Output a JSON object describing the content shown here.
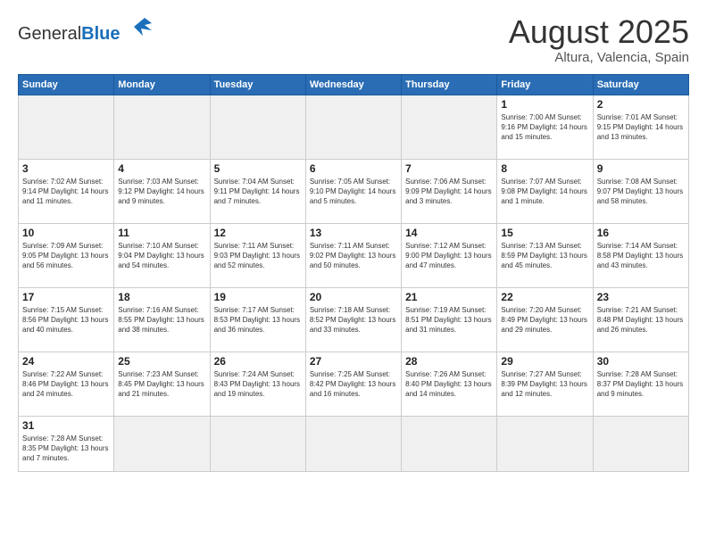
{
  "header": {
    "logo_general": "General",
    "logo_blue": "Blue",
    "title": "August 2025",
    "subtitle": "Altura, Valencia, Spain"
  },
  "weekdays": [
    "Sunday",
    "Monday",
    "Tuesday",
    "Wednesday",
    "Thursday",
    "Friday",
    "Saturday"
  ],
  "weeks": [
    [
      {
        "day": "",
        "info": "",
        "empty": true
      },
      {
        "day": "",
        "info": "",
        "empty": true
      },
      {
        "day": "",
        "info": "",
        "empty": true
      },
      {
        "day": "",
        "info": "",
        "empty": true
      },
      {
        "day": "",
        "info": "",
        "empty": true
      },
      {
        "day": "1",
        "info": "Sunrise: 7:00 AM\nSunset: 9:16 PM\nDaylight: 14 hours\nand 15 minutes."
      },
      {
        "day": "2",
        "info": "Sunrise: 7:01 AM\nSunset: 9:15 PM\nDaylight: 14 hours\nand 13 minutes."
      }
    ],
    [
      {
        "day": "3",
        "info": "Sunrise: 7:02 AM\nSunset: 9:14 PM\nDaylight: 14 hours\nand 11 minutes."
      },
      {
        "day": "4",
        "info": "Sunrise: 7:03 AM\nSunset: 9:12 PM\nDaylight: 14 hours\nand 9 minutes."
      },
      {
        "day": "5",
        "info": "Sunrise: 7:04 AM\nSunset: 9:11 PM\nDaylight: 14 hours\nand 7 minutes."
      },
      {
        "day": "6",
        "info": "Sunrise: 7:05 AM\nSunset: 9:10 PM\nDaylight: 14 hours\nand 5 minutes."
      },
      {
        "day": "7",
        "info": "Sunrise: 7:06 AM\nSunset: 9:09 PM\nDaylight: 14 hours\nand 3 minutes."
      },
      {
        "day": "8",
        "info": "Sunrise: 7:07 AM\nSunset: 9:08 PM\nDaylight: 14 hours\nand 1 minute."
      },
      {
        "day": "9",
        "info": "Sunrise: 7:08 AM\nSunset: 9:07 PM\nDaylight: 13 hours\nand 58 minutes."
      }
    ],
    [
      {
        "day": "10",
        "info": "Sunrise: 7:09 AM\nSunset: 9:05 PM\nDaylight: 13 hours\nand 56 minutes."
      },
      {
        "day": "11",
        "info": "Sunrise: 7:10 AM\nSunset: 9:04 PM\nDaylight: 13 hours\nand 54 minutes."
      },
      {
        "day": "12",
        "info": "Sunrise: 7:11 AM\nSunset: 9:03 PM\nDaylight: 13 hours\nand 52 minutes."
      },
      {
        "day": "13",
        "info": "Sunrise: 7:11 AM\nSunset: 9:02 PM\nDaylight: 13 hours\nand 50 minutes."
      },
      {
        "day": "14",
        "info": "Sunrise: 7:12 AM\nSunset: 9:00 PM\nDaylight: 13 hours\nand 47 minutes."
      },
      {
        "day": "15",
        "info": "Sunrise: 7:13 AM\nSunset: 8:59 PM\nDaylight: 13 hours\nand 45 minutes."
      },
      {
        "day": "16",
        "info": "Sunrise: 7:14 AM\nSunset: 8:58 PM\nDaylight: 13 hours\nand 43 minutes."
      }
    ],
    [
      {
        "day": "17",
        "info": "Sunrise: 7:15 AM\nSunset: 8:56 PM\nDaylight: 13 hours\nand 40 minutes."
      },
      {
        "day": "18",
        "info": "Sunrise: 7:16 AM\nSunset: 8:55 PM\nDaylight: 13 hours\nand 38 minutes."
      },
      {
        "day": "19",
        "info": "Sunrise: 7:17 AM\nSunset: 8:53 PM\nDaylight: 13 hours\nand 36 minutes."
      },
      {
        "day": "20",
        "info": "Sunrise: 7:18 AM\nSunset: 8:52 PM\nDaylight: 13 hours\nand 33 minutes."
      },
      {
        "day": "21",
        "info": "Sunrise: 7:19 AM\nSunset: 8:51 PM\nDaylight: 13 hours\nand 31 minutes."
      },
      {
        "day": "22",
        "info": "Sunrise: 7:20 AM\nSunset: 8:49 PM\nDaylight: 13 hours\nand 29 minutes."
      },
      {
        "day": "23",
        "info": "Sunrise: 7:21 AM\nSunset: 8:48 PM\nDaylight: 13 hours\nand 26 minutes."
      }
    ],
    [
      {
        "day": "24",
        "info": "Sunrise: 7:22 AM\nSunset: 8:46 PM\nDaylight: 13 hours\nand 24 minutes."
      },
      {
        "day": "25",
        "info": "Sunrise: 7:23 AM\nSunset: 8:45 PM\nDaylight: 13 hours\nand 21 minutes."
      },
      {
        "day": "26",
        "info": "Sunrise: 7:24 AM\nSunset: 8:43 PM\nDaylight: 13 hours\nand 19 minutes."
      },
      {
        "day": "27",
        "info": "Sunrise: 7:25 AM\nSunset: 8:42 PM\nDaylight: 13 hours\nand 16 minutes."
      },
      {
        "day": "28",
        "info": "Sunrise: 7:26 AM\nSunset: 8:40 PM\nDaylight: 13 hours\nand 14 minutes."
      },
      {
        "day": "29",
        "info": "Sunrise: 7:27 AM\nSunset: 8:39 PM\nDaylight: 13 hours\nand 12 minutes."
      },
      {
        "day": "30",
        "info": "Sunrise: 7:28 AM\nSunset: 8:37 PM\nDaylight: 13 hours\nand 9 minutes."
      }
    ],
    [
      {
        "day": "31",
        "info": "Sunrise: 7:28 AM\nSunset: 8:35 PM\nDaylight: 13 hours\nand 7 minutes."
      },
      {
        "day": "",
        "info": "",
        "empty": true
      },
      {
        "day": "",
        "info": "",
        "empty": true
      },
      {
        "day": "",
        "info": "",
        "empty": true
      },
      {
        "day": "",
        "info": "",
        "empty": true
      },
      {
        "day": "",
        "info": "",
        "empty": true
      },
      {
        "day": "",
        "info": "",
        "empty": true
      }
    ]
  ]
}
